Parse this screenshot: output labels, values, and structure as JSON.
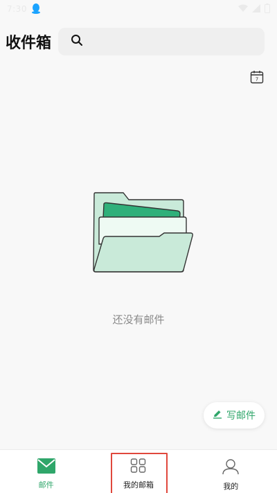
{
  "status_bar": {
    "time": "7:30",
    "icons": [
      "qq-icon",
      "wifi-icon",
      "signal-icon",
      "battery-icon"
    ]
  },
  "header": {
    "title": "收件箱",
    "search": {
      "placeholder": "",
      "value": ""
    }
  },
  "empty_state": {
    "message": "还没有邮件"
  },
  "compose": {
    "label": "写邮件"
  },
  "calendar": {
    "day": "7"
  },
  "bottom_nav": {
    "items": [
      {
        "label": "邮件",
        "icon": "mail-icon",
        "active": true
      },
      {
        "label": "我的邮箱",
        "icon": "grid-icon",
        "active": false
      },
      {
        "label": "我的",
        "icon": "person-icon",
        "active": false
      }
    ]
  },
  "colors": {
    "accent": "#2fa66a",
    "highlight_box": "#e0473c",
    "folder_fill": "#c9ead9",
    "folder_dark": "#2fb07a"
  }
}
